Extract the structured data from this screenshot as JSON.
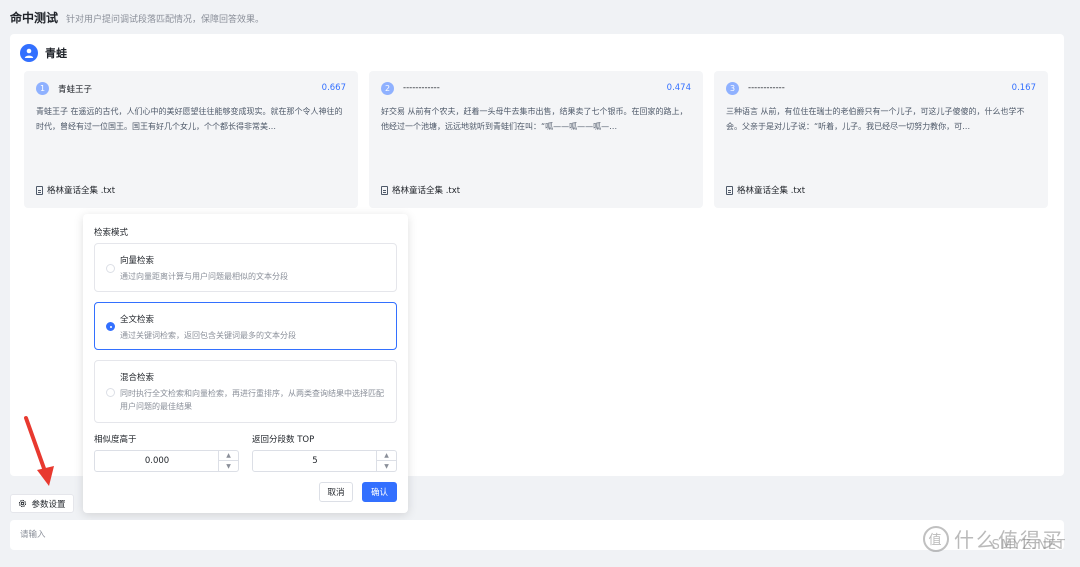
{
  "header": {
    "title": "命中测试",
    "subtitle": "针对用户提问调试段落匹配情况，保障回答效果。"
  },
  "query": {
    "text": "青蛙"
  },
  "results": [
    {
      "index": "1",
      "title": "青蛙王子",
      "score": "0.667",
      "content": "青蛙王子 在遥远的古代，人们心中的美好愿望往往能够变成现实。就在那个令人神往的时代，曾经有过一位国王。国王有好几个女儿，个个都长得非常美…",
      "file": "格林童话全集 .txt"
    },
    {
      "index": "2",
      "title": "------------",
      "score": "0.474",
      "content": "好交易 从前有个农夫，赶着一头母牛去集市出售，结果卖了七个银币。在回家的路上，他经过一个池塘，远远地就听到青蛙们在叫：“呱——呱——呱—…",
      "file": "格林童话全集 .txt"
    },
    {
      "index": "3",
      "title": "------------",
      "score": "0.167",
      "content": "三种语言 从前，有位住在瑞士的老伯爵只有一个儿子，可这儿子傻傻的，什么也学不会。父亲于是对儿子说：“听着，儿子。我已经尽一切努力教你，可…",
      "file": "格林童话全集 .txt"
    }
  ],
  "popover": {
    "title": "检索模式",
    "options": [
      {
        "name": "向量检索",
        "desc": "通过向量距离计算与用户问题最相似的文本分段",
        "selected": false
      },
      {
        "name": "全文检索",
        "desc": "通过关键词检索，返回包含关键词最多的文本分段",
        "selected": true
      },
      {
        "name": "混合检索",
        "desc": "同时执行全文检索和向量检索，再进行重排序，从两类查询结果中选择匹配用户问题的最佳结果",
        "selected": false
      }
    ],
    "similarity_label": "相似度高于",
    "similarity_value": "0.000",
    "topk_label": "返回分段数 TOP",
    "topk_value": "5",
    "cancel_label": "取消",
    "confirm_label": "确认"
  },
  "settings_button": {
    "label": "参数设置",
    "icon": "gear-icon"
  },
  "chat_input": {
    "placeholder": "请输入"
  },
  "watermark": {
    "logo_char": "值",
    "text": "什么值得买",
    "sub": "SMYZ.NET"
  },
  "colors": {
    "accent": "#3370ff",
    "background": "#f0f2f5",
    "card": "#f4f5f7",
    "annotation_arrow": "#e8392f"
  }
}
